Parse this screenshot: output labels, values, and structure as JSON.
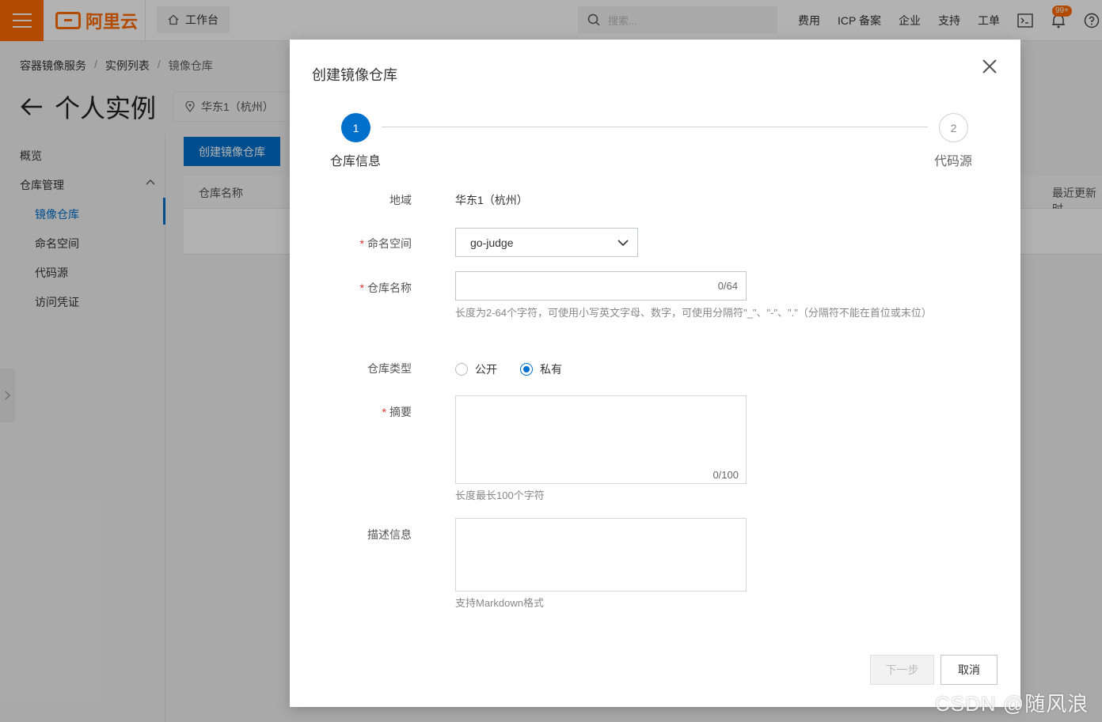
{
  "topbar": {
    "logo_text": "阿里云",
    "workbench": "工作台",
    "search_placeholder": "搜索...",
    "nav": [
      "费用",
      "ICP 备案",
      "企业",
      "支持",
      "工单"
    ],
    "notification_badge": "99+",
    "accent_color": "#ff6a00"
  },
  "breadcrumb": [
    "容器镜像服务",
    "实例列表",
    "镜像仓库"
  ],
  "page": {
    "title": "个人实例",
    "region": "华东1（杭州）",
    "create_button": "创建镜像仓库",
    "table_headers": [
      "仓库名称",
      "最近更新时"
    ]
  },
  "sidebar": {
    "overview": "概览",
    "group": "仓库管理",
    "items": [
      "镜像仓库",
      "命名空间",
      "代码源",
      "访问凭证"
    ]
  },
  "dialog": {
    "title": "创建镜像仓库",
    "steps": [
      {
        "num": "1",
        "label": "仓库信息",
        "status": "active"
      },
      {
        "num": "2",
        "label": "代码源",
        "status": "pending"
      }
    ],
    "fields": {
      "region": {
        "label": "地域",
        "value": "华东1（杭州）"
      },
      "namespace": {
        "label": "命名空间",
        "value": "go-judge",
        "required": true
      },
      "repo_name": {
        "label": "仓库名称",
        "value": "",
        "counter": "0/64",
        "required": true,
        "hint": "长度为2-64个字符，可使用小写英文字母、数字，可使用分隔符\"_\"、\"-\"、\".\"（分隔符不能在首位或末位）"
      },
      "repo_type": {
        "label": "仓库类型",
        "options": [
          "公开",
          "私有"
        ],
        "selected": "私有"
      },
      "summary": {
        "label": "摘要",
        "value": "",
        "counter": "0/100",
        "required": true,
        "hint": "长度最长100个字符"
      },
      "description": {
        "label": "描述信息",
        "value": "",
        "hint": "支持Markdown格式"
      }
    },
    "buttons": {
      "next": "下一步",
      "cancel": "取消"
    },
    "primary_color": "#0070cc"
  },
  "watermark": "CSDN @随风浪仔"
}
